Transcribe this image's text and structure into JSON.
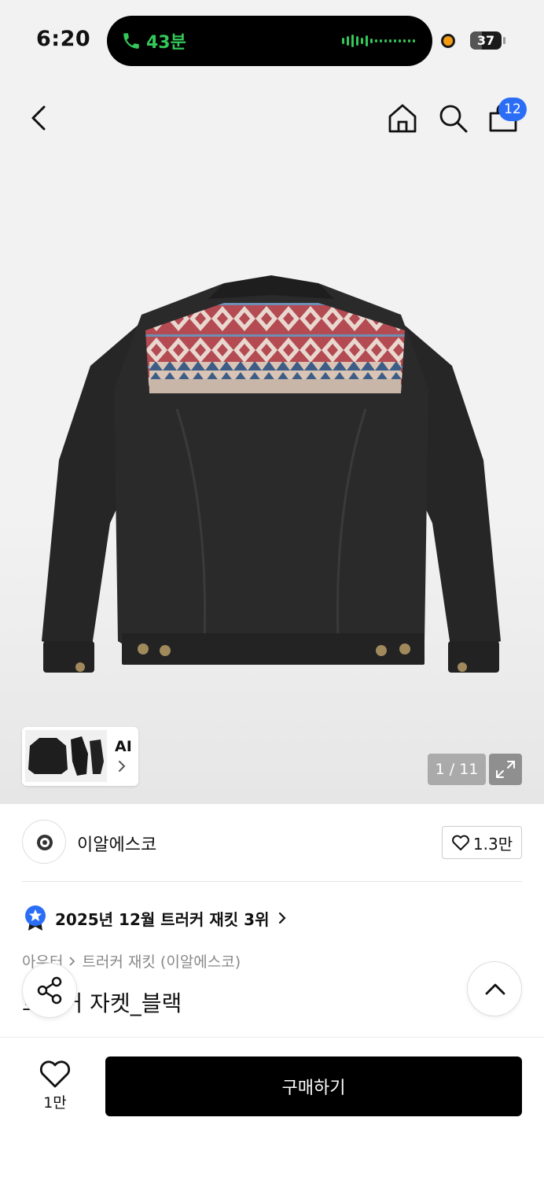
{
  "status_bar": {
    "time": "6:20",
    "call_duration": "43분",
    "battery_level": "37",
    "battery_fraction": 0.37
  },
  "nav": {
    "cart_count": "12",
    "icons": [
      "back-icon",
      "home-icon",
      "search-icon",
      "cart-icon"
    ]
  },
  "gallery": {
    "thumbnail_label": "AI",
    "page_counter": "1 / 11",
    "current_page": 1,
    "total_pages": 11
  },
  "brand": {
    "name": "이알에스코",
    "likes": "1.3만"
  },
  "ranking": {
    "text": "2025년 12월 트러커 재킷 3위"
  },
  "breadcrumb": {
    "category": "아우터",
    "subcategory": "트러커 재킷 (이알에스코)"
  },
  "product": {
    "title": "트러커 자켓_블랙"
  },
  "bottom_bar": {
    "wish_count": "1만",
    "buy_label": "구매하기"
  },
  "colors": {
    "accent": "#2b6ef5",
    "call_green": "#34c759",
    "buy_button": "#000000"
  }
}
